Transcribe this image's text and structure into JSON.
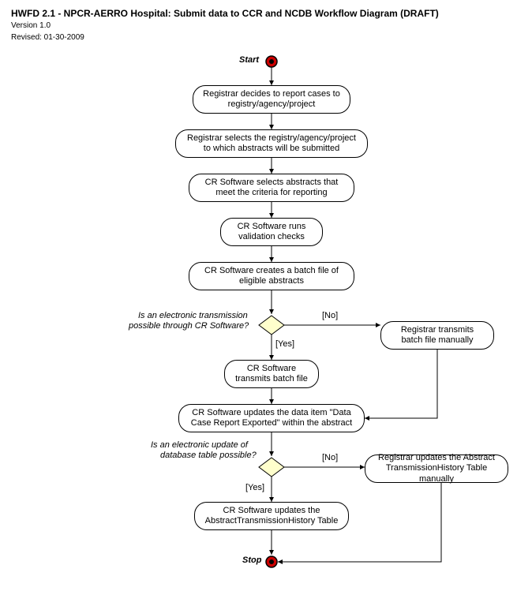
{
  "header": {
    "title": "HWFD 2.1 - NPCR-AERRO Hospital:  Submit data to CCR and NCDB Workflow Diagram (DRAFT)",
    "version": "Version 1.0",
    "revised": "Revised: 01-30-2009"
  },
  "labels": {
    "start": "Start",
    "stop": "Stop",
    "yes": "[Yes]",
    "no": "[No]"
  },
  "questions": {
    "q1a": "Is an electronic transmission",
    "q1b": "possible through CR Software?",
    "q2a": "Is an electronic update of",
    "q2b": "database table possible?"
  },
  "nodes": {
    "n1": "Registrar decides to report cases to registry/agency/project",
    "n2": "Registrar selects the registry/agency/project to which abstracts will be submitted",
    "n3": "CR Software selects abstracts that meet the criteria for reporting",
    "n4": "CR Software runs validation checks",
    "n5": "CR Software creates a batch file of eligible abstracts",
    "n6": "CR Software transmits batch file",
    "n7": "CR Software updates the data item \"Data Case Report Exported\" within the abstract",
    "n8": "CR Software updates the AbstractTransmissionHistory Table",
    "m1": "Registrar transmits batch file manually",
    "m2": "Registrar updates the Abstract TransmissionHistory Table manually"
  }
}
